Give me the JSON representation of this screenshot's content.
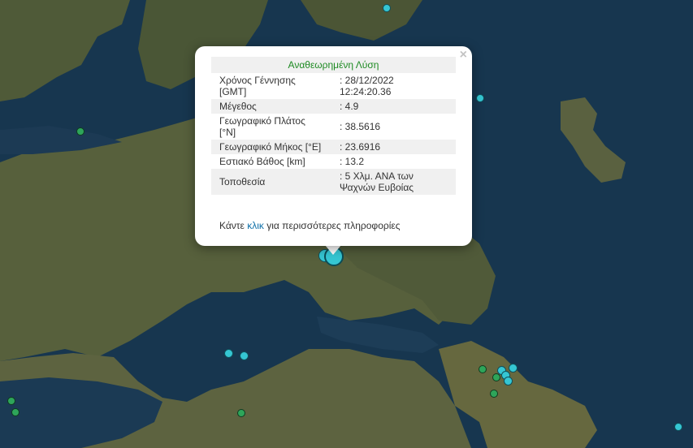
{
  "popup": {
    "header": "Αναθεωρημένη Λύση",
    "close_symbol": "×",
    "rows": [
      {
        "label": "Χρόνος Γέννησης [GMT]",
        "value": ": 28/12/2022 12:24:20.36"
      },
      {
        "label": "Μέγεθος",
        "value": ": 4.9"
      },
      {
        "label": "Γεωγραφικό Πλάτος [°N]",
        "value": ": 38.5616"
      },
      {
        "label": "Γεωγραφικό Μήκος [°E]",
        "value": ": 23.6916"
      },
      {
        "label": "Εστιακό Βάθος [km]",
        "value": ": 13.2"
      },
      {
        "label": "Τοποθεσία",
        "value": ": 5 Χλμ. ΑΝΑ των Ψαχνών Ευβοίας"
      }
    ],
    "more_prefix": "Κάντε ",
    "more_link": "κλικ",
    "more_suffix": " για περισσότερες πληροφορίες"
  },
  "colors": {
    "marker_recent": "#35c6d3",
    "marker_older": "#2ea55a",
    "header_text": "#1d8a22",
    "link": "#0f70a8"
  }
}
